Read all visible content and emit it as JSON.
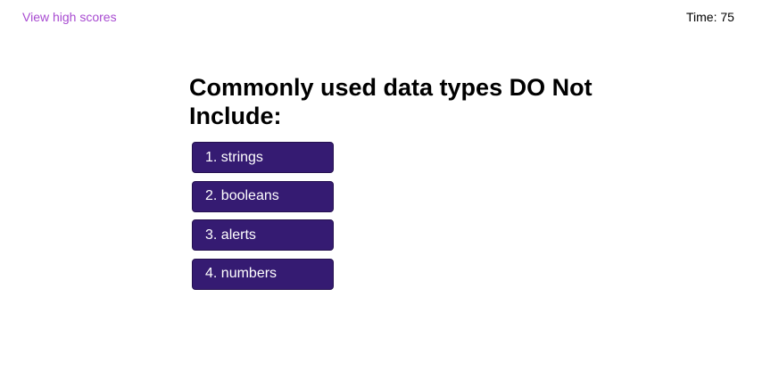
{
  "header": {
    "high_scores_label": "View high scores",
    "timer_label": "Time: 75"
  },
  "quiz": {
    "question": "Commonly used data types DO Not Include:",
    "choices": [
      "1. strings",
      "2. booleans",
      "3. alerts",
      "4. numbers"
    ]
  },
  "colors": {
    "link": "#a84bd1",
    "choice_background": "#351b72",
    "choice_text": "#ffffff"
  }
}
